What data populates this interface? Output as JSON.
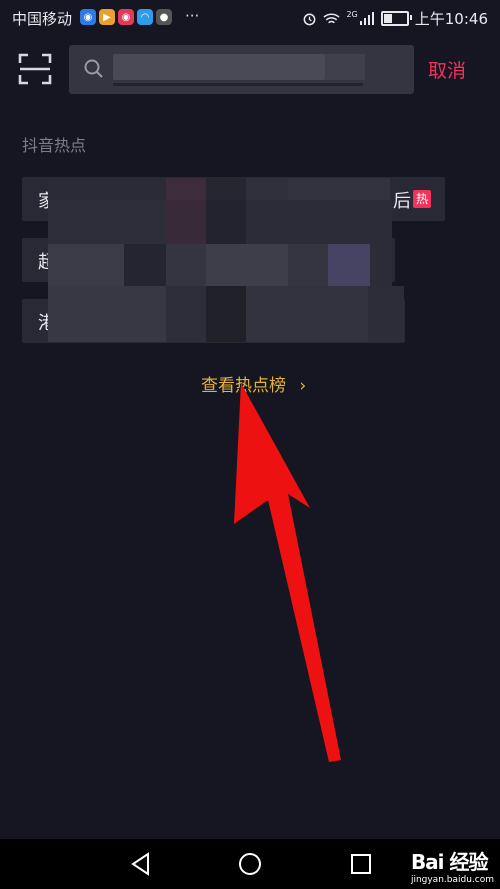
{
  "status_bar": {
    "carrier": "中国移动",
    "more": "···",
    "network_type": "2G",
    "time": "上午10:46",
    "battery_level": 0.35
  },
  "search": {
    "cancel_label": "取消"
  },
  "hot_section": {
    "title": "抖音热点",
    "items": [
      {
        "lead_char": "家",
        "trail_char": "后",
        "badge": "热"
      },
      {
        "lead_char": "超"
      },
      {
        "lead_char": "港"
      }
    ],
    "view_more_label": "查看热点榜",
    "view_more_chevron": "›"
  },
  "watermark": {
    "logo": "Bai 经验",
    "url": "jingyan.baidu.com"
  },
  "colors": {
    "background": "#161622",
    "accent": "#f0335a",
    "link": "#e6b333",
    "annotation_arrow": "#ee1111"
  },
  "icons": [
    "scan-icon",
    "search-icon",
    "back-icon",
    "home-icon",
    "recent-apps-icon",
    "alarm-icon",
    "wifi-icon",
    "signal-icon",
    "battery-icon"
  ]
}
